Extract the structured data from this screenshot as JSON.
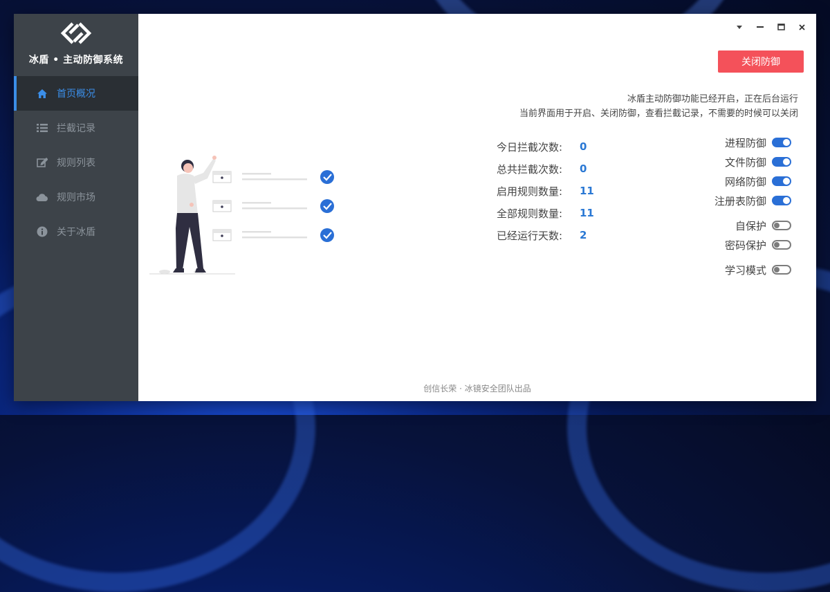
{
  "app": {
    "title": "冰盾 • 主动防御系统"
  },
  "sidebar": {
    "items": [
      {
        "label": "首页概况",
        "icon": "home-icon",
        "active": true
      },
      {
        "label": "拦截记录",
        "icon": "list-icon",
        "active": false
      },
      {
        "label": "规则列表",
        "icon": "edit-icon",
        "active": false
      },
      {
        "label": "规则市场",
        "icon": "cloud-icon",
        "active": false
      },
      {
        "label": "关于冰盾",
        "icon": "info-icon",
        "active": false
      }
    ]
  },
  "window_controls": {
    "dropdown": "▾",
    "minimize": "–",
    "maximize": "□",
    "close": "×"
  },
  "main": {
    "toggle_button": "关闭防御",
    "desc_line1": "冰盾主动防御功能已经开启，正在后台运行",
    "desc_line2": "当前界面用于开启、关闭防御，查看拦截记录，不需要的时候可以关闭",
    "stats": [
      {
        "label": "今日拦截次数:",
        "value": "0"
      },
      {
        "label": "总共拦截次数:",
        "value": "0"
      },
      {
        "label": "启用规则数量:",
        "value": "11"
      },
      {
        "label": "全部规则数量:",
        "value": "11"
      },
      {
        "label": "已经运行天数:",
        "value": "2"
      }
    ],
    "switches": [
      {
        "label": "进程防御",
        "on": true
      },
      {
        "label": "文件防御",
        "on": true
      },
      {
        "label": "网络防御",
        "on": true
      },
      {
        "label": "注册表防御",
        "on": true
      },
      {
        "label": "自保护",
        "on": false
      },
      {
        "label": "密码保护",
        "on": false
      },
      {
        "label": "学习模式",
        "on": false
      }
    ],
    "footer": "创信长荣 · 冰镜安全团队出品"
  },
  "colors": {
    "accent": "#2a6fd6",
    "danger": "#f4515a",
    "sidebar": "#3d4349"
  }
}
